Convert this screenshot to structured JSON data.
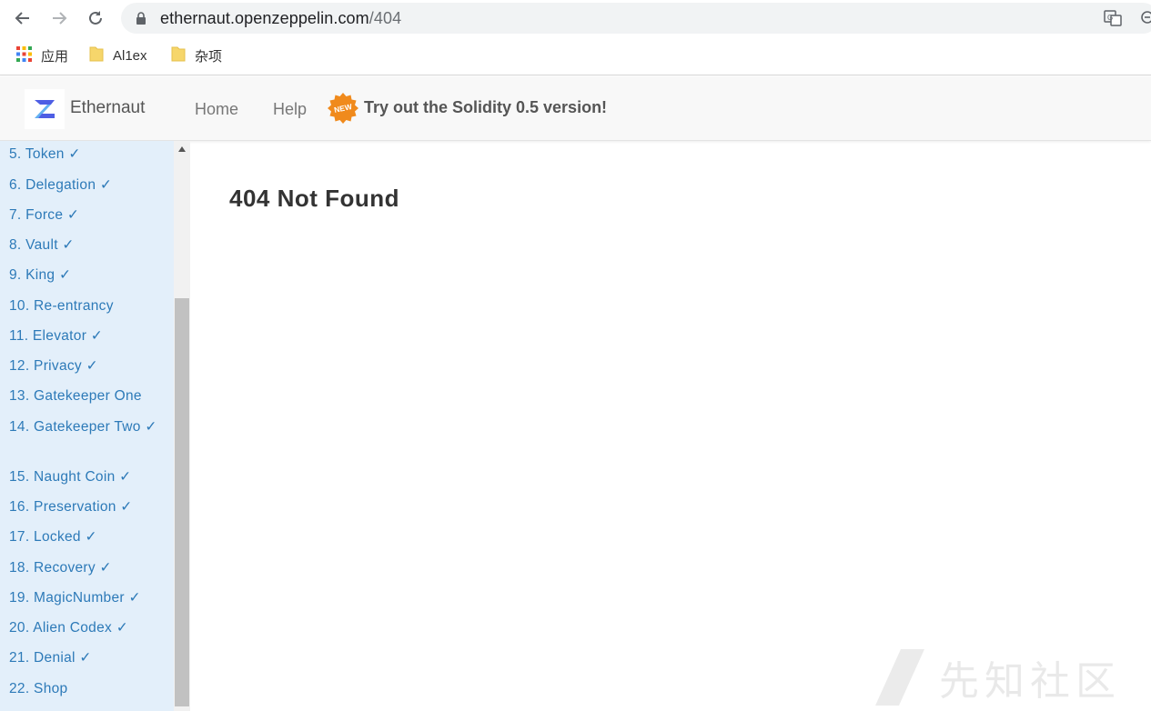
{
  "browser": {
    "url_host": "ethernaut.openzeppelin.com",
    "url_path": "/404",
    "bookmarks": [
      {
        "label": "应用",
        "icon": "apps-grid-icon"
      },
      {
        "label": "Al1ex",
        "icon": "folder-icon"
      },
      {
        "label": "杂项",
        "icon": "folder-icon"
      }
    ]
  },
  "header": {
    "brand": "Ethernaut",
    "nav": [
      "Home",
      "Help"
    ],
    "badge": "NEW",
    "promo": "Try out the Solidity 0.5 version!"
  },
  "sidebar": {
    "levels": [
      {
        "label": "5. Token",
        "check": "✓"
      },
      {
        "label": "6. Delegation",
        "check": "✓"
      },
      {
        "label": "7. Force",
        "check": "✓"
      },
      {
        "label": "8. Vault",
        "check": "✓"
      },
      {
        "label": "9. King",
        "check": "✓"
      },
      {
        "label": "10. Re-entrancy",
        "check": ""
      },
      {
        "label": "11. Elevator",
        "check": "✓"
      },
      {
        "label": "12. Privacy",
        "check": "✓"
      },
      {
        "label": "13. Gatekeeper One",
        "check": ""
      },
      {
        "label": "14. Gatekeeper Two",
        "check": "✓"
      },
      {
        "label": "15. Naught Coin",
        "check": "✓"
      },
      {
        "label": "16. Preservation",
        "check": "✓"
      },
      {
        "label": "17. Locked",
        "check": "✓"
      },
      {
        "label": "18. Recovery",
        "check": "✓"
      },
      {
        "label": "19. MagicNumber",
        "check": "✓"
      },
      {
        "label": "20. Alien Codex",
        "check": "✓"
      },
      {
        "label": "21. Denial",
        "check": "✓"
      },
      {
        "label": "22. Shop",
        "check": ""
      }
    ]
  },
  "main": {
    "title": "404 Not Found"
  },
  "watermark": {
    "text": "先知社区"
  }
}
